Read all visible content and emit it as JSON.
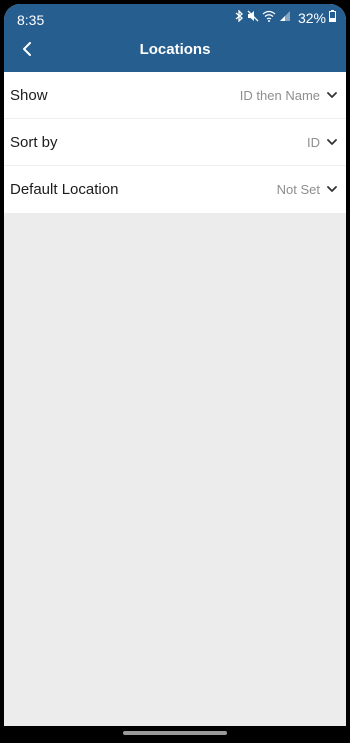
{
  "status_bar": {
    "time": "8:35",
    "battery_percent": "32%",
    "icons": [
      "bluetooth-icon",
      "mute-icon",
      "wifi-icon",
      "signal-icon",
      "battery-icon"
    ]
  },
  "header": {
    "title": "Locations",
    "back_icon": "back-chevron-icon",
    "background_color": "#255e8f"
  },
  "settings": [
    {
      "label": "Show",
      "value": "ID then Name"
    },
    {
      "label": "Sort by",
      "value": "ID"
    },
    {
      "label": "Default Location",
      "value": "Not Set"
    }
  ],
  "colors": {
    "page_background": "#ececec",
    "value_text": "#8e8e8e"
  }
}
